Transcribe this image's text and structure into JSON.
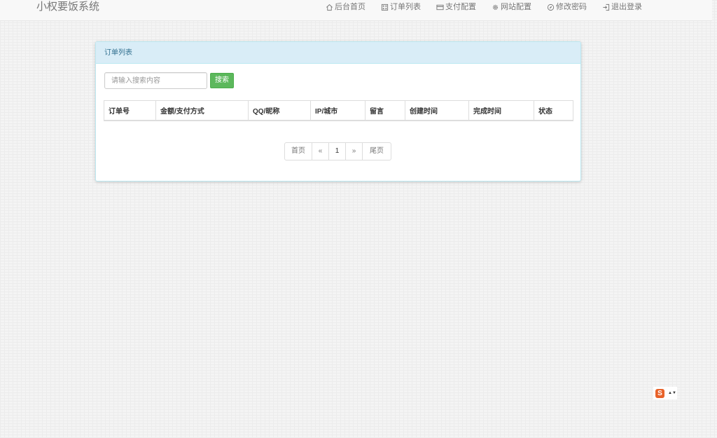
{
  "app": {
    "brand": "小权要饭系统"
  },
  "nav": {
    "items": [
      {
        "label": "后台首页",
        "icon": "home-icon"
      },
      {
        "label": "订单列表",
        "icon": "list-icon"
      },
      {
        "label": "支付配置",
        "icon": "card-icon"
      },
      {
        "label": "网站配置",
        "icon": "gear-icon"
      },
      {
        "label": "修改密码",
        "icon": "compass-icon"
      },
      {
        "label": "退出登录",
        "icon": "logout-icon"
      }
    ]
  },
  "panel": {
    "title": "订单列表",
    "search": {
      "placeholder": "请输入搜索内容",
      "value": "",
      "button_label": "搜索"
    },
    "table": {
      "columns": [
        "订单号",
        "金额/支付方式",
        "QQ/昵称",
        "IP/城市",
        "留言",
        "创建时间",
        "完成时间",
        "状态"
      ],
      "rows": []
    },
    "pagination": {
      "first": "首页",
      "prev": "«",
      "current": "1",
      "next": "»",
      "last": "尾页"
    }
  },
  "widget": {
    "logo_letter": "S",
    "arrows": "▲▼",
    "accent": "#e8622a"
  },
  "colors": {
    "panel_heading_bg": "#d9edf7",
    "panel_heading_text": "#31708f",
    "search_button": "#5cb85c"
  }
}
